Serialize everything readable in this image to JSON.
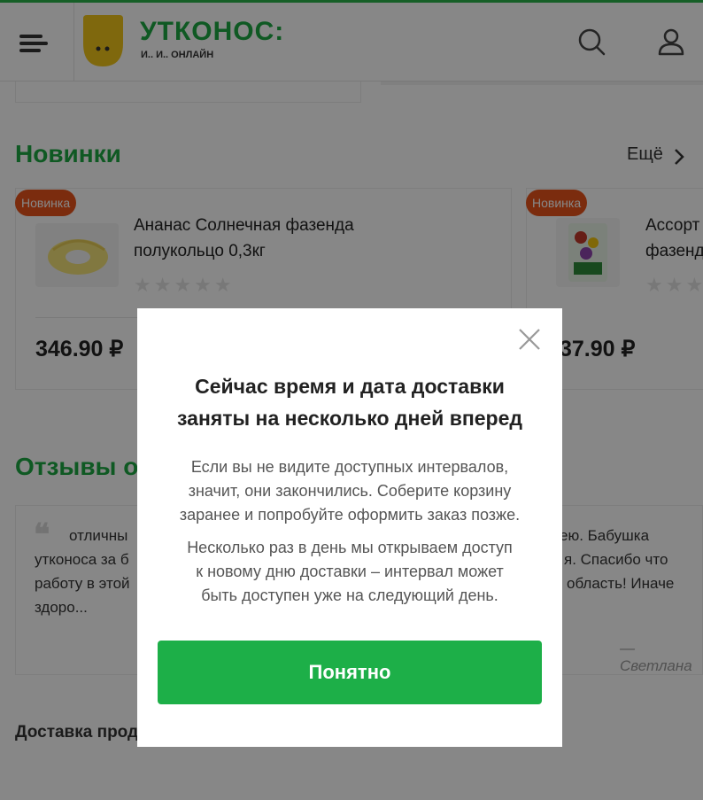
{
  "header": {
    "logo_title": "УТКОНОС:",
    "logo_subtitle": "И.. И.. ОНЛАЙН"
  },
  "new_section": {
    "title": "Новинки",
    "more_label": "Ещё",
    "products": [
      {
        "badge": "Новинка",
        "name_line1": "Ананас Солнечная фазенда",
        "name_line2": "полукольцо 0,3кг",
        "rating_stars": "★★★★★",
        "price": "346.90 ₽"
      },
      {
        "badge": "Новинка",
        "name_line1": "Ассорт",
        "name_line2": "фазенд",
        "rating_stars": "★★★",
        "price": "37.90 ₽"
      }
    ]
  },
  "reviews_section": {
    "title": "Отзывы о с",
    "quote_mark": "❝",
    "left_lines": [
      "отличны",
      "утконоса за б",
      "работу в этой",
      "здоро..."
    ],
    "right_lines": [
      "ею. Бабушка",
      "я. Спасибо что",
      "область! Иначе"
    ],
    "author": "— Светлана"
  },
  "footer": {
    "delivery_link": "Доставка прод"
  },
  "modal": {
    "title_line1": "Сейчас время и дата доставки",
    "title_line2": "заняты на несколько дней вперед",
    "p1_line1": "Если вы не видите доступных интервалов,",
    "p1_line2": "значит, они закончились. Соберите корзину",
    "p1_line3": "заранее и попробуйте оформить заказ позже.",
    "p2_line1": "Несколько раз в день мы открываем доступ",
    "p2_line2": "к новому дню доставки – интервал может",
    "p2_line3": "быть доступен уже на следующий день.",
    "button_label": "Понятно"
  },
  "colors": {
    "brand_green": "#1da843",
    "button_green": "#1daf48",
    "badge_orange": "#e8541b",
    "logo_yellow": "#f0c419"
  },
  "icons": [
    "menu-icon",
    "logo-icon",
    "search-icon",
    "user-icon",
    "chevron-right-icon",
    "close-icon",
    "quote-icon",
    "star-icon"
  ]
}
